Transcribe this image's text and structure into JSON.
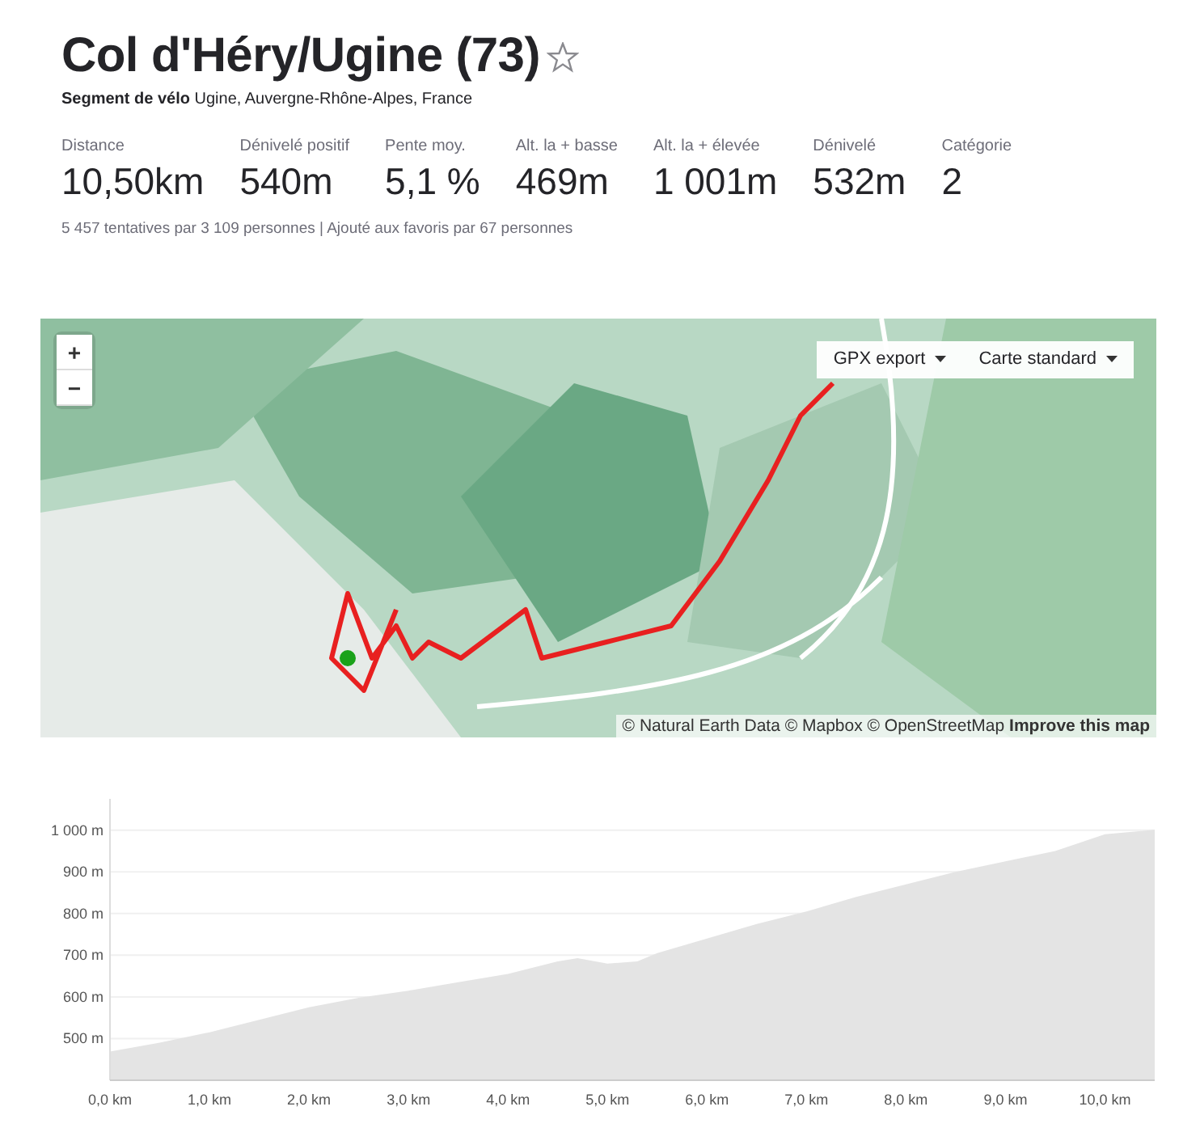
{
  "header": {
    "title": "Col d'Héry/Ugine (73)",
    "favorite": false,
    "subtitle": "**Segment de vélo** Ugine, Auvergne-Rhône-Alpes, France"
  },
  "stats": [
    {
      "label": "Distance",
      "value": "10,50km"
    },
    {
      "label": "Dénivelé positif",
      "value": "540m"
    },
    {
      "label": "Pente moy.",
      "value": "5,1 %"
    },
    {
      "label": "Alt. la + basse",
      "value": "469m"
    },
    {
      "label": "Alt. la + élevée",
      "value": "1 001m"
    },
    {
      "label": "Dénivelé",
      "value": "532m"
    },
    {
      "label": "Catégorie",
      "value": "2"
    }
  ],
  "attempts": "5 457 tentatives par 3 109 personnes | Ajouté aux favoris par 67 personnes",
  "map": {
    "kind": "picture",
    "zoom_in": "+",
    "zoom_out": "−",
    "menus": [
      "GPX export",
      "Carte standard"
    ],
    "attribution": "© Natural Earth Data © Mapbox © OpenStreetMap",
    "improve_link": "Improve this map"
  },
  "elevation": {
    "chart_data": {
      "type": "area",
      "x": [
        0,
        0.5,
        1,
        1.5,
        2,
        2.5,
        3,
        3.5,
        4,
        4.5,
        4.7,
        5,
        5.3,
        5.5,
        6,
        6.5,
        7,
        7.5,
        8,
        8.5,
        9,
        9.5,
        10,
        10.5
      ],
      "grid": true,
      "series": [
        {
          "color": "#e4e4e4",
          "values": [
            469,
            490,
            515,
            545,
            575,
            598,
            615,
            635,
            655,
            685,
            693,
            680,
            685,
            705,
            740,
            775,
            805,
            840,
            870,
            900,
            925,
            950,
            990,
            1001
          ]
        }
      ],
      "xlim": [
        0,
        10.5
      ],
      "ylim": [
        400,
        1075
      ],
      "xticks": [
        {
          "value": 0,
          "label": "0,0 km"
        },
        {
          "value": 1,
          "label": "1,0 km"
        },
        {
          "value": 2,
          "label": "2,0 km"
        },
        {
          "value": 3,
          "label": "3,0 km"
        },
        {
          "value": 4,
          "label": "4,0 km"
        },
        {
          "value": 5,
          "label": "5,0 km"
        },
        {
          "value": 6,
          "label": "6,0 km"
        },
        {
          "value": 7,
          "label": "7,0 km"
        },
        {
          "value": 8,
          "label": "8,0 km"
        },
        {
          "value": 9,
          "label": "9,0 km"
        },
        {
          "value": 10,
          "label": "10,0 km"
        }
      ],
      "yticks": [
        {
          "value": 500,
          "label": "500 m"
        },
        {
          "value": 600,
          "label": "600 m"
        },
        {
          "value": 700,
          "label": "700 m"
        },
        {
          "value": 800,
          "label": "800 m"
        },
        {
          "value": 900,
          "label": "900 m"
        },
        {
          "value": 1000,
          "label": "1 000 m"
        }
      ]
    }
  }
}
